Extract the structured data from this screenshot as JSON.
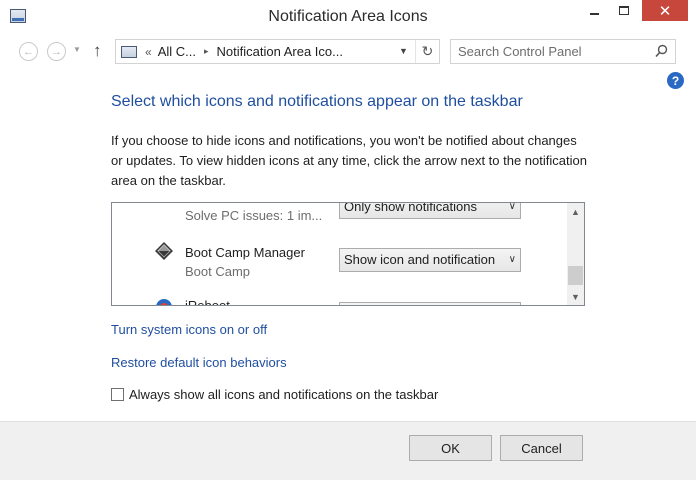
{
  "window": {
    "title": "Notification Area Icons",
    "close_glyph": "✕"
  },
  "address": {
    "overflow_glyph": "«",
    "crumbs": [
      "All C...",
      "Notification Area Ico..."
    ],
    "separator_glyph": "▸"
  },
  "search": {
    "placeholder": "Search Control Panel"
  },
  "help": {
    "glyph": "?"
  },
  "main": {
    "heading": "Select which icons and notifications appear on the taskbar",
    "description": "If you choose to hide icons and notifications, you won't be notified about changes or updates. To view hidden icons at any time, click the arrow next to the notification area on the taskbar.",
    "icons_list": [
      {
        "name": "",
        "subtitle": "Solve PC issues: 1 im...",
        "behavior": "Only show notifications",
        "icon": "flag-icon"
      },
      {
        "name": "Boot Camp Manager",
        "subtitle": "Boot Camp",
        "behavior": "Show icon and notification",
        "icon": "boot-camp-icon"
      },
      {
        "name": "iReboot",
        "subtitle": "",
        "behavior": "",
        "icon": "ireboot-icon"
      }
    ],
    "links": {
      "system_icons": "Turn system icons on or off",
      "restore_defaults": "Restore default icon behaviors"
    },
    "always_show": {
      "label": "Always show all icons and notifications on the taskbar",
      "checked": false
    }
  },
  "footer": {
    "ok_label": "OK",
    "cancel_label": "Cancel"
  },
  "colors": {
    "heading": "#1f4e9f",
    "link": "#1f4e9f",
    "close_button": "#c7473d",
    "help_icon": "#2a69c3"
  }
}
